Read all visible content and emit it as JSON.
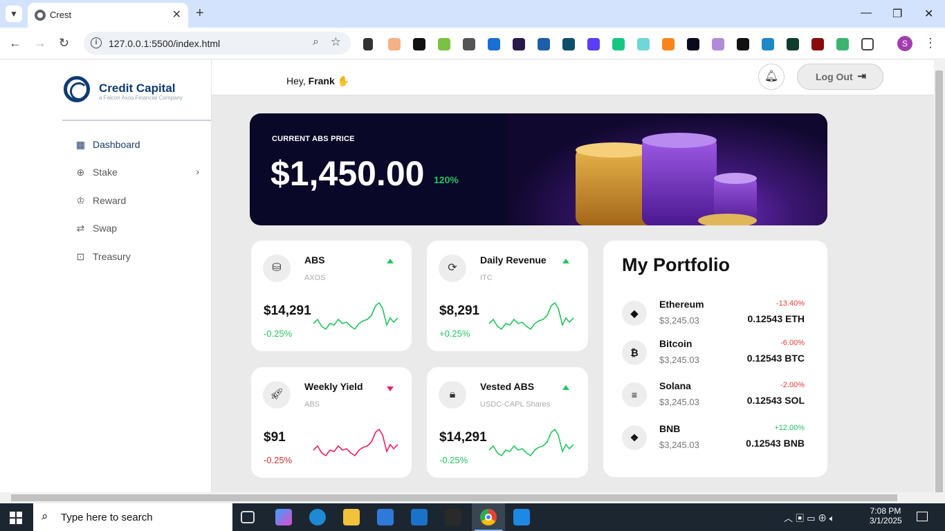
{
  "browser": {
    "tab_title": "Crest",
    "url": "127.0.0.1:5500/index.html",
    "profile_initial": "S"
  },
  "sidebar": {
    "brand": "Credit Capital",
    "tagline": "a Falcon Axos Financial Company",
    "items": [
      {
        "label": "Dashboard",
        "icon": "grid-icon",
        "active": true
      },
      {
        "label": "Stake",
        "icon": "stake-icon",
        "has_submenu": true
      },
      {
        "label": "Reward",
        "icon": "crown-icon"
      },
      {
        "label": "Swap",
        "icon": "swap-icon"
      },
      {
        "label": "Treasury",
        "icon": "treasury-icon"
      }
    ]
  },
  "header": {
    "greeting": "Hey,",
    "user": "Frank",
    "logout_label": "Log Out"
  },
  "hero": {
    "label": "CURRENT ABS PRICE",
    "price": "$1,450.00",
    "change": "120%"
  },
  "cards": [
    {
      "title": "ABS",
      "subtitle": "AXOS",
      "value": "$14,291",
      "change": "-0.25%",
      "trend": "up",
      "change_color": "#22c55e",
      "line_color": "#22c55e",
      "icon": "coins-icon"
    },
    {
      "title": "Daily Revenue",
      "subtitle": "ITC",
      "value": "$8,291",
      "change": "+0.25%",
      "trend": "up",
      "change_color": "#22c55e",
      "line_color": "#22c55e",
      "icon": "revenue-icon"
    },
    {
      "title": "Weekly Yield",
      "subtitle": "ABS",
      "value": "$91",
      "change": "-0.25%",
      "trend": "down",
      "change_color": "#d32f2f",
      "line_color": "#e91e63",
      "icon": "rocket-icon"
    },
    {
      "title": "Vested ABS",
      "subtitle": "USDC-CAPL Shares",
      "value": "$14,291",
      "change": "-0.25%",
      "trend": "up",
      "change_color": "#22c55e",
      "line_color": "#22c55e",
      "icon": "lock-icon"
    }
  ],
  "portfolio": {
    "title": "My Portfolio",
    "assets": [
      {
        "name": "Ethereum",
        "price": "$3,245.03",
        "change": "-13.40%",
        "amount": "0.12543 ETH",
        "change_color": "#e53935",
        "icon": "ethereum-icon",
        "glyph": "◆"
      },
      {
        "name": "Bitcoin",
        "price": "$3,245.03",
        "change": "-6.00%",
        "amount": "0.12543 BTC",
        "change_color": "#e53935",
        "icon": "bitcoin-icon",
        "glyph": "₿"
      },
      {
        "name": "Solana",
        "price": "$3,245.03",
        "change": "-2.00%",
        "amount": "0.12543 SOL",
        "change_color": "#e53935",
        "icon": "solana-icon",
        "glyph": "≡"
      },
      {
        "name": "BNB",
        "price": "$3,245.03",
        "change": "+12.00%",
        "amount": "0.12543 BNB",
        "change_color": "#22c55e",
        "icon": "bnb-icon",
        "glyph": "❖"
      }
    ]
  },
  "taskbar": {
    "search_placeholder": "Type here to search",
    "time": "7:08 PM",
    "date": "3/1/2025"
  }
}
